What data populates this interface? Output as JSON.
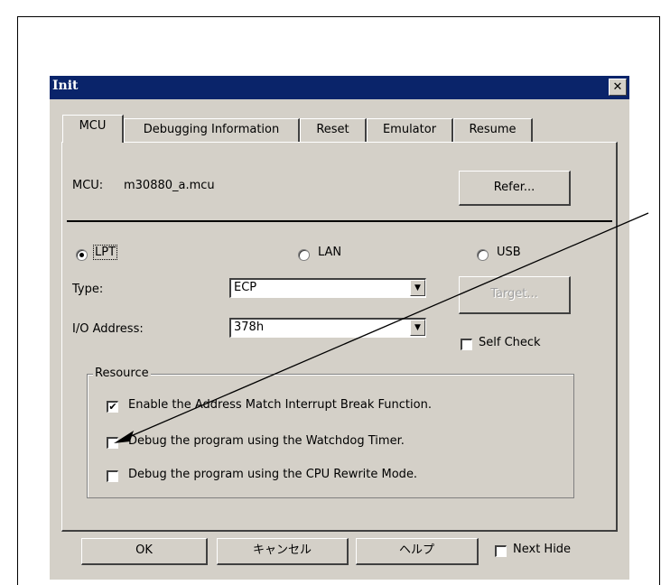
{
  "page": {
    "top_caption": "—————"
  },
  "dialog": {
    "title": "Init",
    "close_glyph": "✕",
    "tabs": [
      {
        "label": "MCU",
        "active": true
      },
      {
        "label": "Debugging Information",
        "active": false
      },
      {
        "label": "Reset",
        "active": false
      },
      {
        "label": "Emulator",
        "active": false
      },
      {
        "label": "Resume",
        "active": false
      }
    ],
    "mcu": {
      "label": "MCU:",
      "value": "m30880_a.mcu",
      "refer_button": "Refer..."
    },
    "connection": {
      "options": [
        {
          "label": "LPT",
          "selected": true
        },
        {
          "label": "LAN",
          "selected": false
        },
        {
          "label": "USB",
          "selected": false
        }
      ]
    },
    "type": {
      "label": "Type:",
      "value": "ECP"
    },
    "io_address": {
      "label": "I/O Address:",
      "value": "378h"
    },
    "target_button": "Target...",
    "self_check": {
      "label": "Self Check",
      "checked": false
    },
    "resource": {
      "legend": "Resource",
      "items": [
        {
          "label": "Enable the Address Match Interrupt Break Function.",
          "checked": true
        },
        {
          "label": "Debug the program using the Watchdog Timer.",
          "checked": false
        },
        {
          "label": "Debug the program using the CPU Rewrite Mode.",
          "checked": false
        }
      ]
    },
    "buttons": {
      "ok": "OK",
      "cancel": "キャンセル",
      "help": "ヘルプ"
    },
    "next_hide": {
      "label": "Next Hide",
      "checked": false
    }
  },
  "icons": {
    "close": "close-icon",
    "dropdown": "chevron-down-icon",
    "check": "checkmark-icon"
  },
  "colors": {
    "dialog_bg": "#d4d0c8",
    "titlebar_bg": "#0a246a",
    "title_text": "#ffffff"
  }
}
